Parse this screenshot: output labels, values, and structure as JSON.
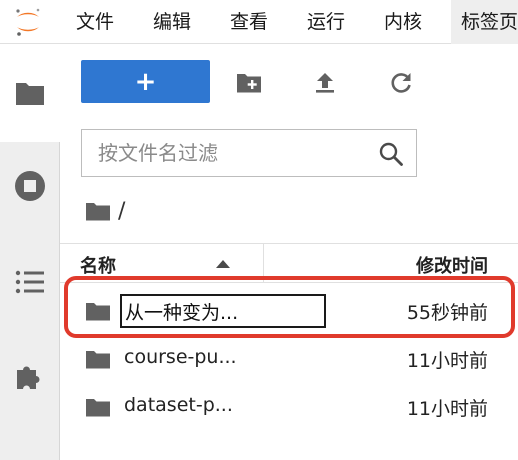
{
  "menu": {
    "items": [
      "文件",
      "编辑",
      "查看",
      "运行",
      "内核",
      "标签页"
    ]
  },
  "sidebar": {
    "icons": [
      "folder-icon",
      "stop-circle-icon",
      "list-icon",
      "puzzle-icon"
    ]
  },
  "toolbar": {
    "new_label": "+",
    "icons": [
      "new-folder-icon",
      "upload-icon",
      "refresh-icon"
    ]
  },
  "filter": {
    "placeholder": "按文件名过滤",
    "value": ""
  },
  "breadcrumb": {
    "path": "/"
  },
  "listing": {
    "header_name": "名称",
    "header_modified": "修改时间",
    "rows": [
      {
        "name": "从一种变为...",
        "modified": "55秒钟前",
        "renaming": true
      },
      {
        "name": "course-pu...",
        "modified": "11小时前",
        "renaming": false
      },
      {
        "name": "dataset-p...",
        "modified": "11小时前",
        "renaming": false
      }
    ]
  },
  "colors": {
    "accent": "#2f77d1",
    "logo_orange": "#f37726",
    "highlight_red": "#e03a2c",
    "icon_gray": "#616161"
  }
}
